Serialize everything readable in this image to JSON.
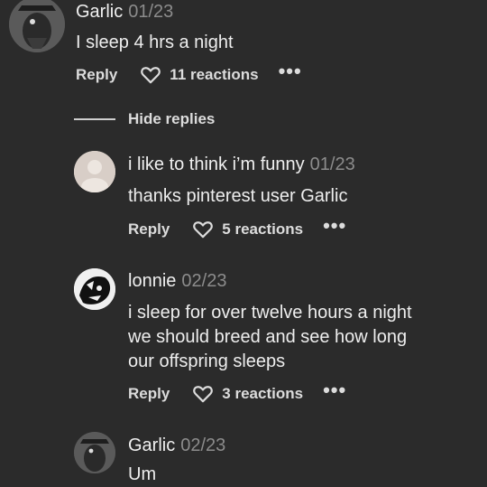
{
  "colors": {
    "background": "#2b2b2b",
    "text": "#eeeeee",
    "muted": "#8c8c8c"
  },
  "comments": [
    {
      "author": "Garlic",
      "date": "01/23",
      "lines": [
        "I sleep 4 hrs a night"
      ],
      "reply_label": "Reply",
      "reactions": "11 reactions",
      "more": "•••",
      "avatar_icon": "dark-bird-avatar"
    }
  ],
  "hide_replies_label": "Hide replies",
  "replies": [
    {
      "author": "i like to think i’m funny",
      "date": "01/23",
      "lines": [
        "thanks pinterest user Garlic"
      ],
      "reply_label": "Reply",
      "reactions": "5 reactions",
      "more": "•••",
      "avatar_icon": "default-user-avatar"
    },
    {
      "author": "lonnie",
      "date": "02/23",
      "lines": [
        "i sleep for over twelve hours a night",
        "we should breed and see how long",
        "our offspring sleeps"
      ],
      "reply_label": "Reply",
      "reactions": "3 reactions",
      "more": "•••",
      "avatar_icon": "ink-drawing-avatar"
    },
    {
      "author": "Garlic",
      "date": "02/23",
      "lines": [
        "Um"
      ],
      "avatar_icon": "dark-bird-avatar"
    }
  ]
}
